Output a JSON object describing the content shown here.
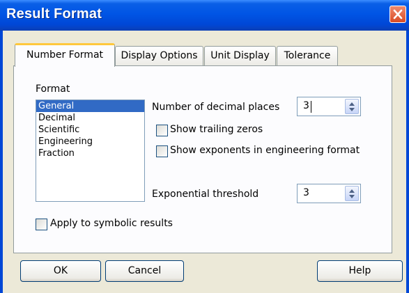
{
  "dialog": {
    "title": "Result Format",
    "close_icon": "close-icon"
  },
  "tabs": [
    {
      "label": "Number Format",
      "active": true
    },
    {
      "label": "Display Options",
      "active": false
    },
    {
      "label": "Unit Display",
      "active": false
    },
    {
      "label": "Tolerance",
      "active": false
    }
  ],
  "format": {
    "group_label": "Format",
    "options": [
      "General",
      "Decimal",
      "Scientific",
      "Engineering",
      "Fraction"
    ],
    "selected": "General"
  },
  "decimal_places": {
    "label": "Number of decimal places",
    "value": "3"
  },
  "show_trailing_zeros": {
    "label": "Show trailing zeros",
    "checked": false
  },
  "show_exponents_engineering": {
    "label": "Show exponents in engineering format",
    "checked": false
  },
  "exponential_threshold": {
    "label": "Exponential threshold",
    "value": "3"
  },
  "apply_symbolic": {
    "label": "Apply to symbolic results",
    "checked": false
  },
  "buttons": {
    "ok": "OK",
    "cancel": "Cancel",
    "help": "Help"
  }
}
